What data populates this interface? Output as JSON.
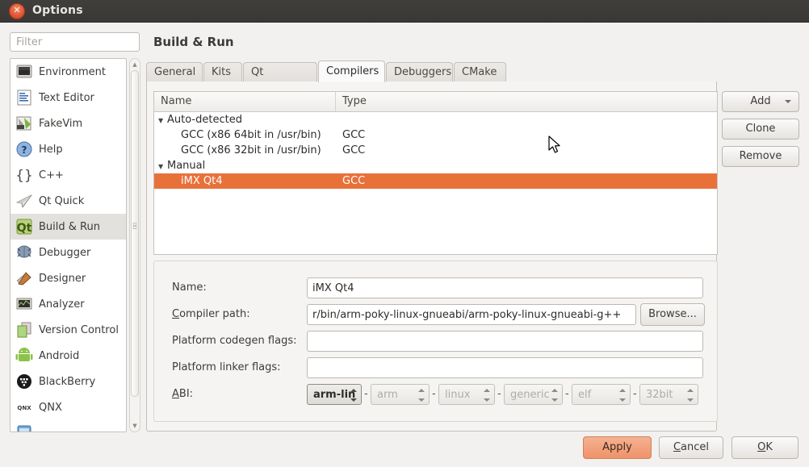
{
  "window": {
    "title": "Options",
    "close_icon": "close-icon"
  },
  "sidebar": {
    "filter_placeholder": "Filter",
    "filter_value": "",
    "items": [
      {
        "label": "Environment",
        "icon": "environment-icon",
        "selected": false
      },
      {
        "label": "Text Editor",
        "icon": "text-editor-icon",
        "selected": false
      },
      {
        "label": "FakeVim",
        "icon": "fakevim-icon",
        "selected": false
      },
      {
        "label": "Help",
        "icon": "help-icon",
        "selected": false
      },
      {
        "label": "C++",
        "icon": "cpp-icon",
        "selected": false
      },
      {
        "label": "Qt Quick",
        "icon": "qt-quick-icon",
        "selected": false
      },
      {
        "label": "Build & Run",
        "icon": "build-and-run-icon",
        "selected": true
      },
      {
        "label": "Debugger",
        "icon": "debugger-icon",
        "selected": false
      },
      {
        "label": "Designer",
        "icon": "designer-icon",
        "selected": false
      },
      {
        "label": "Analyzer",
        "icon": "analyzer-icon",
        "selected": false
      },
      {
        "label": "Version Control",
        "icon": "version-control-icon",
        "selected": false
      },
      {
        "label": "Android",
        "icon": "android-icon",
        "selected": false
      },
      {
        "label": "BlackBerry",
        "icon": "blackberry-icon",
        "selected": false
      },
      {
        "label": "QNX",
        "icon": "qnx-icon",
        "selected": false
      }
    ]
  },
  "page": {
    "title": "Build & Run",
    "tabs": [
      {
        "label": "General",
        "active": false
      },
      {
        "label": "Kits",
        "active": false
      },
      {
        "label": "Qt Versions",
        "active": false
      },
      {
        "label": "Compilers",
        "active": true
      },
      {
        "label": "Debuggers",
        "active": false
      },
      {
        "label": "CMake",
        "active": false
      }
    ]
  },
  "table": {
    "columns": [
      "Name",
      "Type"
    ],
    "rows": [
      {
        "name": "Auto-detected",
        "type": "",
        "level": 0,
        "expanded": true,
        "selected": false
      },
      {
        "name": "GCC (x86 64bit in /usr/bin)",
        "type": "GCC",
        "level": 1,
        "expanded": null,
        "selected": false
      },
      {
        "name": "GCC (x86 32bit in /usr/bin)",
        "type": "GCC",
        "level": 1,
        "expanded": null,
        "selected": false
      },
      {
        "name": "Manual",
        "type": "",
        "level": 0,
        "expanded": true,
        "selected": false
      },
      {
        "name": "iMX Qt4",
        "type": "GCC",
        "level": 1,
        "expanded": null,
        "selected": true
      }
    ]
  },
  "side_buttons": {
    "add": "Add",
    "add_caret": "chevron-down-icon",
    "clone": "Clone",
    "remove": "Remove"
  },
  "form": {
    "name": {
      "label": "Name:",
      "value": "iMX Qt4"
    },
    "compiler_path": {
      "label": "Compiler path:",
      "value": "r/bin/arm-poky-linux-gnueabi/arm-poky-linux-gnueabi-g++",
      "browse": "Browse..."
    },
    "codegen_flags": {
      "label": "Platform codegen flags:",
      "value": ""
    },
    "linker_flags": {
      "label": "Platform linker flags:",
      "value": ""
    },
    "abi": {
      "label": "ABI:",
      "parts": [
        {
          "value": "arm-lin",
          "enabled": true
        },
        {
          "value": "arm",
          "enabled": false
        },
        {
          "value": "linux",
          "enabled": false
        },
        {
          "value": "generic",
          "enabled": false
        },
        {
          "value": "elf",
          "enabled": false
        },
        {
          "value": "32bit",
          "enabled": false
        }
      ],
      "separator": "-"
    }
  },
  "footer": {
    "apply": "Apply",
    "cancel": "Cancel",
    "ok": "OK"
  },
  "colors": {
    "selection": "#e8713a",
    "apply_button": "#ef9269",
    "titlebar": "#3a3836",
    "window_bg": "#f2f1f0"
  }
}
